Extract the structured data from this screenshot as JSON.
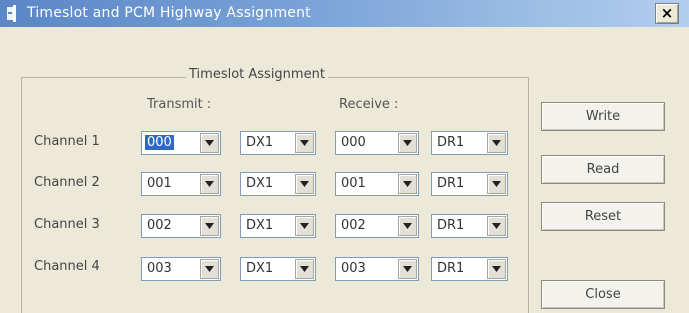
{
  "window": {
    "title": "Timeslot and PCM Highway Assignment",
    "close_label": "×"
  },
  "group": {
    "title": "Timeslot Assignment",
    "transmit_header": "Transmit :",
    "receive_header": "Receive :"
  },
  "channels": [
    {
      "label": "Channel 1",
      "tx_slot": "000",
      "tx_highway": "DX1",
      "rx_slot": "000",
      "rx_highway": "DR1"
    },
    {
      "label": "Channel 2",
      "tx_slot": "001",
      "tx_highway": "DX1",
      "rx_slot": "001",
      "rx_highway": "DR1"
    },
    {
      "label": "Channel 3",
      "tx_slot": "002",
      "tx_highway": "DX1",
      "rx_slot": "002",
      "rx_highway": "DR1"
    },
    {
      "label": "Channel 4",
      "tx_slot": "003",
      "tx_highway": "DX1",
      "rx_slot": "003",
      "rx_highway": "DR1"
    }
  ],
  "buttons": {
    "write": "Write",
    "read": "Read",
    "reset": "Reset",
    "close": "Close"
  },
  "colors": {
    "title_bar": "#5b86c7",
    "selection": "#316ac5",
    "dialog_bg": "#ece9d8"
  }
}
